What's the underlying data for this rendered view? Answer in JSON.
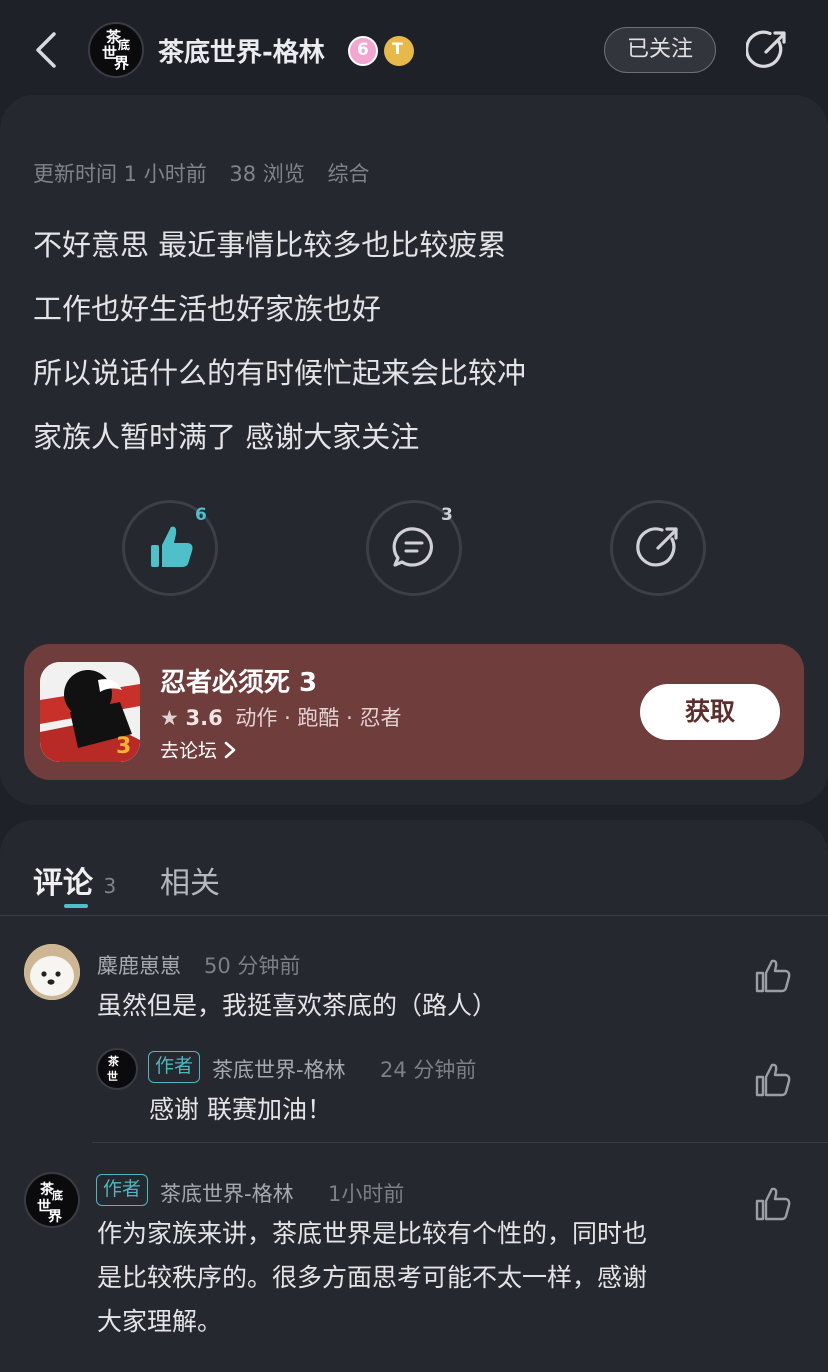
{
  "header": {
    "author_name": "茶底世界-格林",
    "follow_label": "已关注",
    "avatar_chars": [
      "茶",
      "底",
      "世",
      "界"
    ],
    "badge_6": "6",
    "badge_t": "T"
  },
  "post": {
    "meta": {
      "updated": "更新时间 1 小时前",
      "views": "38 浏览",
      "category": "综合"
    },
    "lines": [
      "不好意思 最近事情比较多也比较疲累",
      "工作也好生活也好家族也好",
      "所以说话什么的有时候忙起来会比较冲",
      "家族人暂时满了 感谢大家关注"
    ],
    "actions": {
      "like_count": "6",
      "comment_count": "3"
    }
  },
  "game": {
    "title": "忍者必须死 3",
    "rating": "3.6",
    "tags": "动作 · 跑酷 · 忍者",
    "forum_link": "去论坛",
    "get_label": "获取",
    "icon_number": "3"
  },
  "comments_section": {
    "tabs": [
      {
        "label": "评论",
        "count": "3"
      },
      {
        "label": "相关"
      }
    ],
    "comments": [
      {
        "name": "麋鹿崽崽",
        "time": "50 分钟前",
        "text": "虽然但是，我挺喜欢茶底的（路人）",
        "reply": {
          "tag": "作者",
          "name": "茶底世界-格林",
          "time": "24 分钟前",
          "text": "感谢 联赛加油！"
        }
      },
      {
        "tag": "作者",
        "name": "茶底世界-格林",
        "time": "1小时前",
        "text_lines": [
          "作为家族来讲，茶底世界是比较有个性的，同时也",
          "是比较秩序的。很多方面思考可能不太一样，感谢",
          "大家理解。"
        ]
      }
    ]
  },
  "colors": {
    "background": "#1f2129",
    "card": "#26282f",
    "accent_teal": "#4fc0c9",
    "game_card": "#6e3d3c"
  }
}
